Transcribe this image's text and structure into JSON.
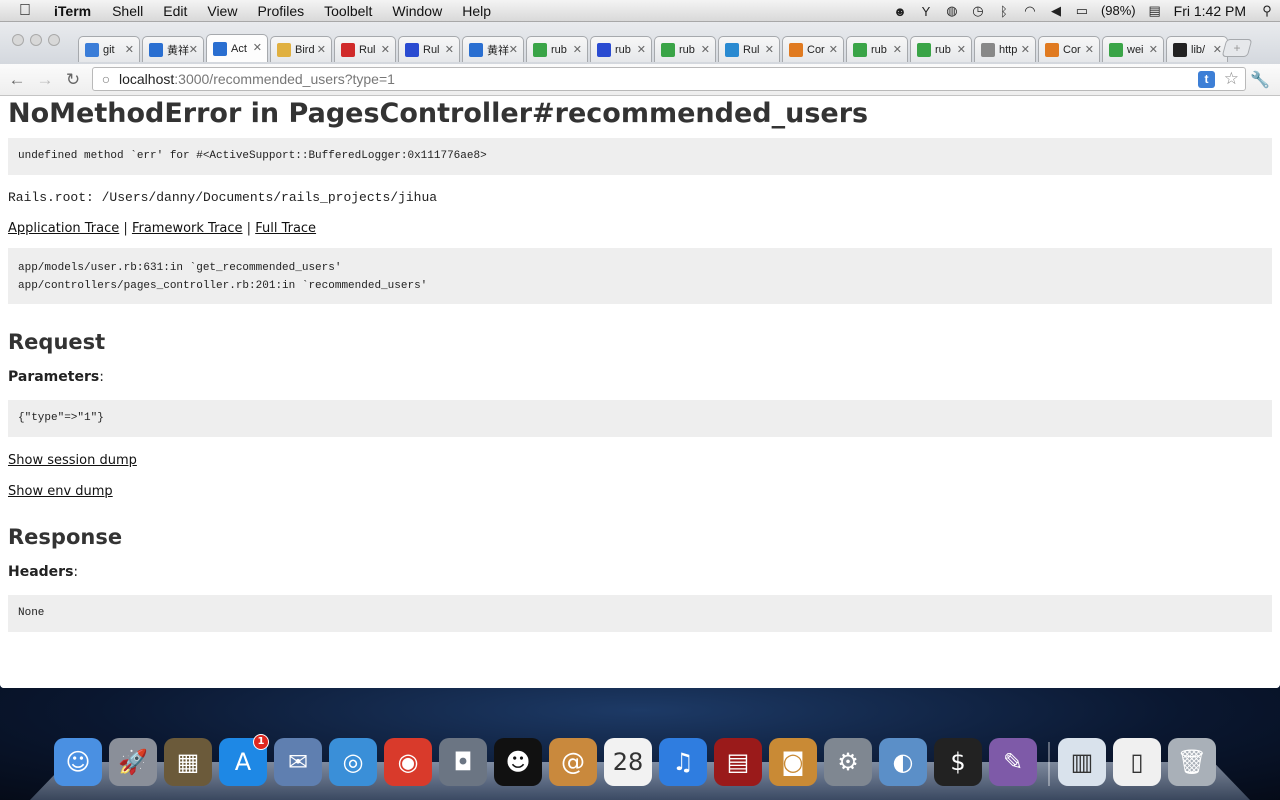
{
  "menubar": {
    "app_name": "iTerm",
    "menus": [
      "Shell",
      "Edit",
      "View",
      "Profiles",
      "Toolbelt",
      "Window",
      "Help"
    ],
    "battery": "(98%)",
    "clock": "Fri 1:42 PM"
  },
  "tabs": [
    {
      "title": "git",
      "fav_color": "#3b7dd8"
    },
    {
      "title": "黄祥",
      "fav_color": "#2a6fd1"
    },
    {
      "title": "Act",
      "fav_color": "#2a6fd1"
    },
    {
      "title": "Bird",
      "fav_color": "#e0b040"
    },
    {
      "title": "Rul",
      "fav_color": "#d02a2a"
    },
    {
      "title": "Rul",
      "fav_color": "#2a4bd1"
    },
    {
      "title": "黄祥",
      "fav_color": "#2a6fd1"
    },
    {
      "title": "rub",
      "fav_color": "#3aa447"
    },
    {
      "title": "rub",
      "fav_color": "#2a4bd1"
    },
    {
      "title": "rub",
      "fav_color": "#3aa447"
    },
    {
      "title": "Rul",
      "fav_color": "#2a8ad1"
    },
    {
      "title": "Cor",
      "fav_color": "#e07a20"
    },
    {
      "title": "rub",
      "fav_color": "#3aa447"
    },
    {
      "title": "rub",
      "fav_color": "#3aa447"
    },
    {
      "title": "http",
      "fav_color": "#888888"
    },
    {
      "title": "Cor",
      "fav_color": "#e07a20"
    },
    {
      "title": "wei",
      "fav_color": "#3aa447"
    },
    {
      "title": "lib/",
      "fav_color": "#222222"
    }
  ],
  "active_tab_index": 2,
  "address": {
    "host": "localhost",
    "path": ":3000/recommended_users?type=1"
  },
  "page": {
    "title": "NoMethodError in PagesController#recommended_users",
    "error_message": "undefined method `err' for #<ActiveSupport::BufferedLogger:0x111776ae8>",
    "rails_root": "Rails.root: /Users/danny/Documents/rails_projects/jihua",
    "trace_links": [
      "Application Trace",
      "Framework Trace",
      "Full Trace"
    ],
    "separator": "|",
    "trace_lines": [
      "app/models/user.rb:631:in `get_recommended_users'",
      "app/controllers/pages_controller.rb:201:in `recommended_users'"
    ],
    "request_heading": "Request",
    "parameters_label": "Parameters",
    "parameters_value": "{\"type\"=>\"1\"}",
    "session_dump_link": "Show session dump",
    "env_dump_link": "Show env dump",
    "response_heading": "Response",
    "headers_label": "Headers",
    "headers_value": "None"
  },
  "dock": [
    {
      "name": "finder",
      "color": "#4a90e2",
      "glyph": "☺"
    },
    {
      "name": "launchpad",
      "color": "#8a8f99",
      "glyph": "🚀"
    },
    {
      "name": "mission-control",
      "color": "#6b5a3a",
      "glyph": "▦"
    },
    {
      "name": "app-store",
      "color": "#1e88e5",
      "glyph": "A",
      "badge": "1"
    },
    {
      "name": "preview",
      "color": "#5f7fb0",
      "glyph": "✉"
    },
    {
      "name": "safari",
      "color": "#3a8fd8",
      "glyph": "◎"
    },
    {
      "name": "chrome",
      "color": "#d93a2b",
      "glyph": "◉"
    },
    {
      "name": "facetime",
      "color": "#6b7583",
      "glyph": "◘"
    },
    {
      "name": "qq",
      "color": "#111111",
      "glyph": "☻"
    },
    {
      "name": "address-book",
      "color": "#c9893d",
      "glyph": "@"
    },
    {
      "name": "calendar",
      "color": "#f2f2f2",
      "glyph": "28"
    },
    {
      "name": "itunes",
      "color": "#2f7de0",
      "glyph": "♫"
    },
    {
      "name": "photo-booth",
      "color": "#9a1a1a",
      "glyph": "▤"
    },
    {
      "name": "iphoto",
      "color": "#c98a35",
      "glyph": "◙"
    },
    {
      "name": "system-preferences",
      "color": "#7f8791",
      "glyph": "⚙"
    },
    {
      "name": "preview-app",
      "color": "#5b8fc8",
      "glyph": "◐"
    },
    {
      "name": "terminal",
      "color": "#222222",
      "glyph": "$"
    },
    {
      "name": "sublime",
      "color": "#7e5aa8",
      "glyph": "✎"
    }
  ],
  "dock_right": [
    {
      "name": "documents-stack",
      "color": "#d9e2ec",
      "glyph": "▥"
    },
    {
      "name": "file-stack",
      "color": "#f0f0f0",
      "glyph": "▯"
    },
    {
      "name": "trash",
      "color": "#a9b0b8",
      "glyph": "🗑"
    }
  ]
}
